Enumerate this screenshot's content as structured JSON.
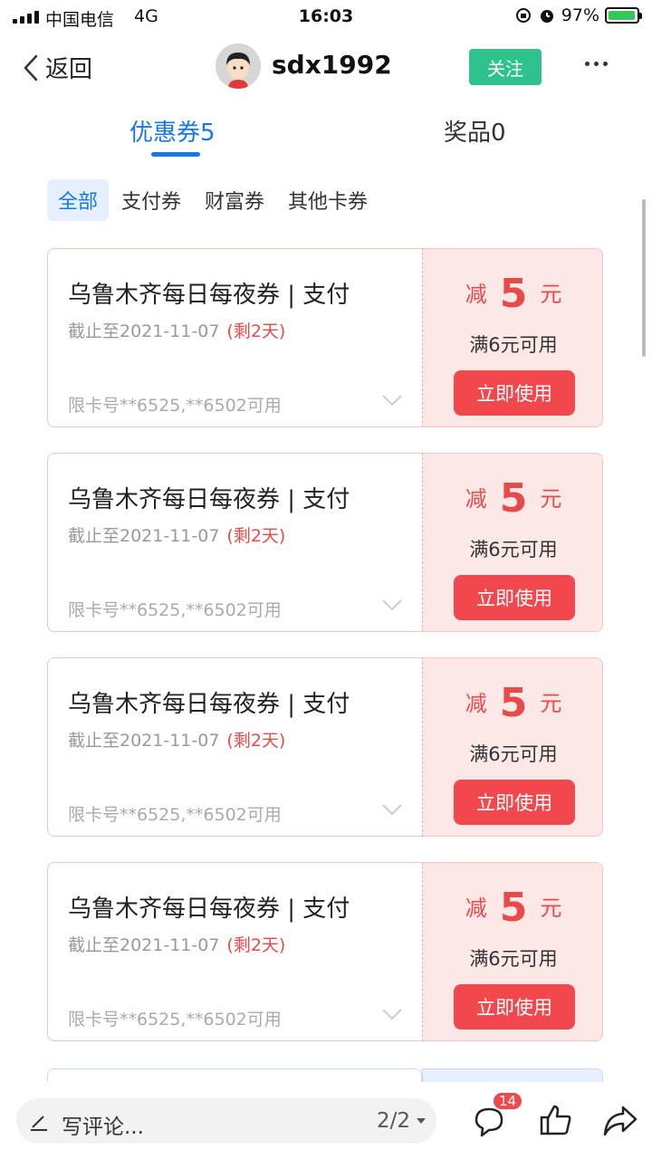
{
  "status_bar": {
    "carrier": "中国电信",
    "network": "4G",
    "time": "16:03",
    "battery": "97%",
    "battery_level": 0.97
  },
  "header": {
    "back_label": "返回",
    "username": "sdx1992",
    "follow_label": "关注"
  },
  "tabs": [
    {
      "label": "优惠券5",
      "active": true
    },
    {
      "label": "奖品0",
      "active": false
    }
  ],
  "filters": [
    {
      "label": "全部",
      "active": true
    },
    {
      "label": "支付券",
      "active": false
    },
    {
      "label": "财富券",
      "active": false
    },
    {
      "label": "其他卡券",
      "active": false
    }
  ],
  "coupons": [
    {
      "title": "乌鲁木齐每日每夜券 | 支付",
      "expiry": "截止至2021-11-07",
      "remaining": "(剩2天)",
      "cards": "限卡号**6525,**6502可用",
      "amount_prefix": "减",
      "amount": "5",
      "unit": "元",
      "condition": "满6元可用",
      "button": "立即使用"
    },
    {
      "title": "乌鲁木齐每日每夜券 | 支付",
      "expiry": "截止至2021-11-07",
      "remaining": "(剩2天)",
      "cards": "限卡号**6525,**6502可用",
      "amount_prefix": "减",
      "amount": "5",
      "unit": "元",
      "condition": "满6元可用",
      "button": "立即使用"
    },
    {
      "title": "乌鲁木齐每日每夜券 | 支付",
      "expiry": "截止至2021-11-07",
      "remaining": "(剩2天)",
      "cards": "限卡号**6525,**6502可用",
      "amount_prefix": "减",
      "amount": "5",
      "unit": "元",
      "condition": "满6元可用",
      "button": "立即使用"
    },
    {
      "title": "乌鲁木齐每日每夜券 | 支付",
      "expiry": "截止至2021-11-07",
      "remaining": "(剩2天)",
      "cards": "限卡号**6525,**6502可用",
      "amount_prefix": "减",
      "amount": "5",
      "unit": "元",
      "condition": "满6元可用",
      "button": "立即使用"
    }
  ],
  "bottom_bar": {
    "comment_placeholder": "写评论...",
    "page_indicator": "2/2",
    "comment_count": "14"
  },
  "colors": {
    "accent_blue": "#1677e6",
    "follow_green": "#2fc28c",
    "coupon_red": "#f2474d",
    "coupon_bg": "#fde8e8"
  },
  "icons": [
    "back-chevron-icon",
    "avatar",
    "more-icon",
    "chevron-down-icon",
    "pen-icon",
    "comment-icon",
    "like-icon",
    "share-icon",
    "alarm-icon",
    "lock-rotation-icon",
    "battery-icon"
  ]
}
